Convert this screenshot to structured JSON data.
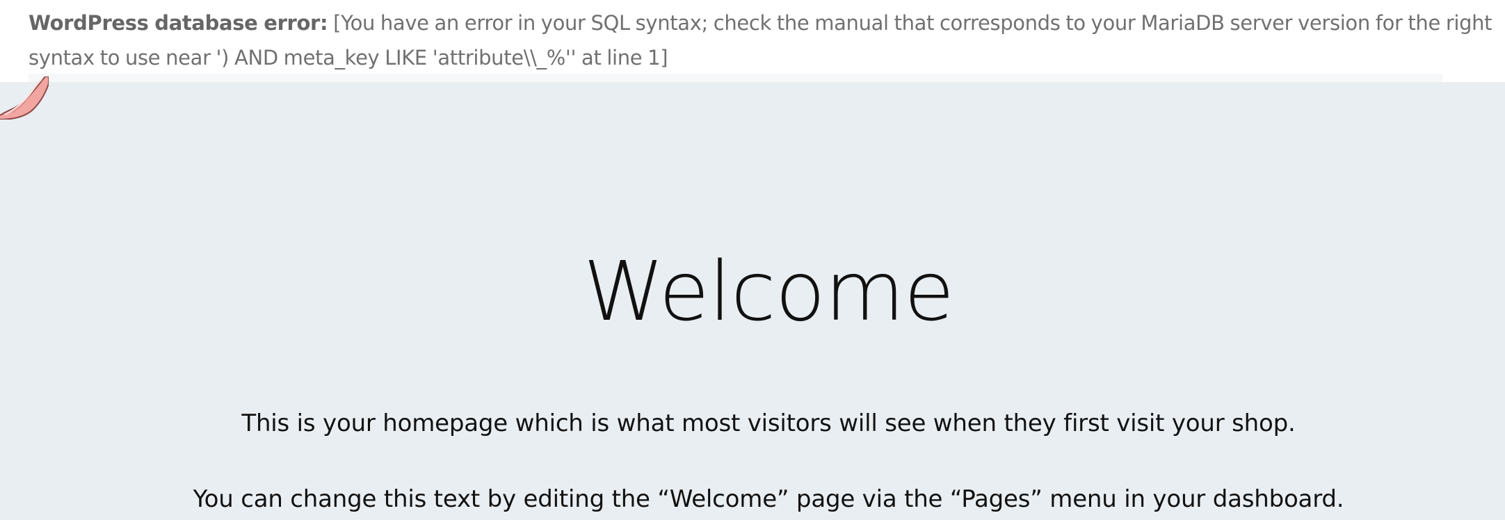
{
  "error": {
    "label": "WordPress database error:",
    "message": "[You have an error in your SQL syntax; check the manual that corresponds to your MariaDB server version for the right syntax to use near ') AND meta_key LIKE 'attribute\\\\_%'' at line 1]"
  },
  "hero": {
    "title": "Welcome",
    "line1": "This is your homepage which is what most visitors will see when they first visit your shop.",
    "line2": "You can change this text by editing the “Welcome” page via the “Pages” menu in your dashboard."
  },
  "colors": {
    "background": "#e9eef2",
    "error_background": "#ffffff",
    "error_text": "#707070",
    "title_text": "#111111"
  },
  "icons": {
    "decor": "coral-leaf-decoration"
  }
}
